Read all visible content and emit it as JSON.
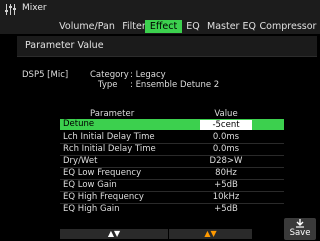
{
  "app": {
    "title": "Mixer"
  },
  "tabs": [
    {
      "label": "Volume/Pan"
    },
    {
      "label": "Filter"
    },
    {
      "label": "Effect"
    },
    {
      "label": "EQ"
    },
    {
      "label": "Master EQ"
    },
    {
      "label": "Compressor"
    }
  ],
  "active_tab": "Effect",
  "section": {
    "title": "Parameter Value"
  },
  "effect": {
    "slot": "DSP5 [Mic]",
    "category_label": "Category",
    "category_value": ": Legacy",
    "type_label": "Type",
    "type_value": ": Ensemble Detune 2"
  },
  "table": {
    "header_parameter": "Parameter",
    "header_value": "Value",
    "rows": [
      {
        "name": "Detune",
        "value": "-5cent"
      },
      {
        "name": "Lch Initial Delay Time",
        "value": "0.0ms"
      },
      {
        "name": "Rch Initial Delay Time",
        "value": "0.0ms"
      },
      {
        "name": "Dry/Wet",
        "value": "D28>W"
      },
      {
        "name": "EQ Low Frequency",
        "value": "80Hz"
      },
      {
        "name": "EQ Low Gain",
        "value": "+5dB"
      },
      {
        "name": "EQ High Frequency",
        "value": "10kHz"
      },
      {
        "name": "EQ High Gain",
        "value": "+5dB"
      }
    ],
    "selected_index": 0
  },
  "pager": {
    "param_arrows": "▲▼",
    "value_arrows": "▲▼"
  },
  "save": {
    "label": "Save",
    "icon": "save-arrow-icon"
  },
  "colors": {
    "accent": "#3cd04e",
    "value_arrows": "#ff9a00",
    "background": "#000000"
  }
}
